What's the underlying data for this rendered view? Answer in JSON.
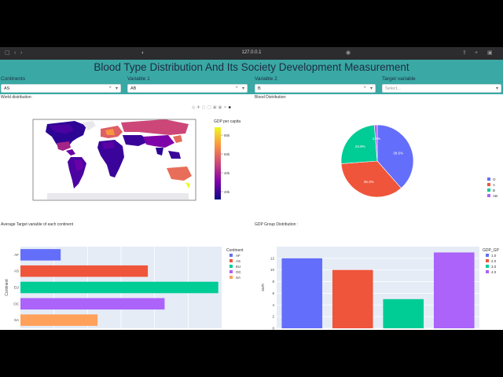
{
  "browser": {
    "url": "127.0.0.1"
  },
  "page_title": "Blood Type Distribution And Its Society Development Measurement",
  "filters": [
    {
      "label": "Continents",
      "value": "AS",
      "placeholder": ""
    },
    {
      "label": "Variable 1",
      "value": "AB",
      "placeholder": ""
    },
    {
      "label": "Variable 2",
      "value": "B",
      "placeholder": ""
    },
    {
      "label": "Target variable",
      "value": "",
      "placeholder": "Select..."
    }
  ],
  "sections": {
    "world": "World distribution:",
    "blood": "Blood Distribution:",
    "avg": "Average Target variable of each continent",
    "gdp": "GDP Group Distribution :"
  },
  "map": {
    "colorbar_title": "GDP per capita",
    "colorbar_ticks": [
      "80k",
      "60k",
      "40k",
      "20k"
    ]
  },
  "colors": {
    "accent": "#3aa8a4",
    "title": "#1d2b44"
  },
  "chart_data": [
    {
      "type": "pie",
      "labels": [
        "O",
        "A",
        "B",
        "AB"
      ],
      "values": [
        38.5,
        35.3,
        24.9,
        1.3
      ],
      "value_labels": [
        "38.5%",
        "35.3%",
        "24.9%",
        "1.3%"
      ],
      "colors": [
        "#636efa",
        "#ef553b",
        "#00cc96",
        "#ab63fa"
      ],
      "legend": "right"
    },
    {
      "type": "bar",
      "orientation": "horizontal",
      "categories": [
        "AF",
        "AS",
        "EU",
        "OC",
        "SA"
      ],
      "values": [
        12,
        38,
        59,
        43,
        23
      ],
      "colors": [
        "#636efa",
        "#ef553b",
        "#00cc96",
        "#ab63fa",
        "#ffa15a"
      ],
      "ylabel": "Continent",
      "legend_title": "Continent",
      "legend_items": [
        "AF",
        "AS",
        "EU",
        "OC",
        "SA"
      ],
      "xlim": [
        0,
        60
      ],
      "grid": true
    },
    {
      "type": "bar",
      "categories": [
        "1.0",
        "2.0",
        "3.0",
        "4.0"
      ],
      "values": [
        12,
        10,
        5,
        13
      ],
      "colors": [
        "#636efa",
        "#ef553b",
        "#00cc96",
        "#ab63fa"
      ],
      "ylabel": "sum",
      "yticks": [
        "0",
        "2",
        "4",
        "6",
        "8",
        "10",
        "12"
      ],
      "ylim": [
        0,
        14
      ],
      "legend_title": "GDP_GP",
      "legend_items": [
        "1.0",
        "2.0",
        "3.0",
        "4.0"
      ]
    }
  ]
}
